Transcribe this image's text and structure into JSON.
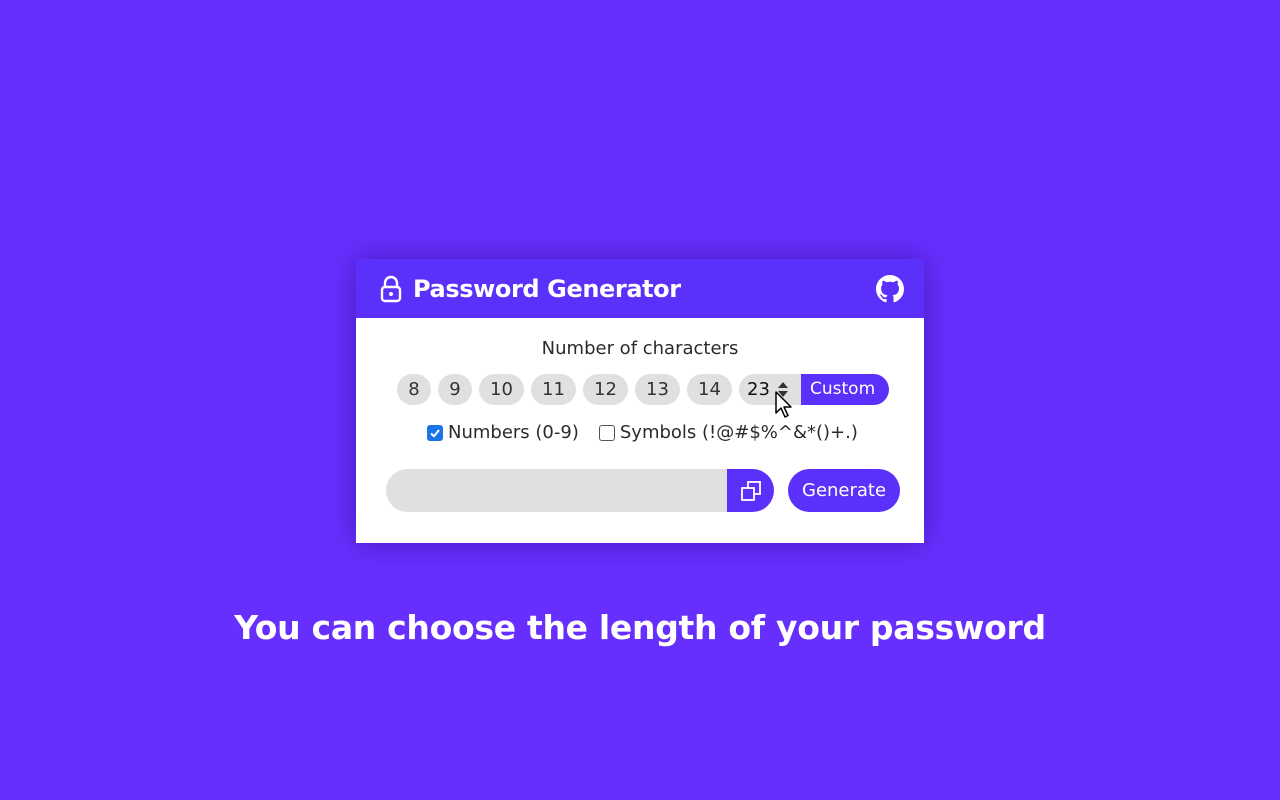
{
  "colors": {
    "background": "#672ffe",
    "accent": "#5b30fa",
    "pill": "#e0e0e0",
    "checkbox_checked": "#1a73e8"
  },
  "header": {
    "title": "Password Generator",
    "lock_icon": "lock-icon",
    "github_icon": "github-icon"
  },
  "length": {
    "label": "Number of characters",
    "options": [
      "8",
      "9",
      "10",
      "11",
      "12",
      "13",
      "14"
    ],
    "custom_value": "23",
    "custom_label": "Custom"
  },
  "options": {
    "numbers": {
      "label": "Numbers (0-9)",
      "checked": true
    },
    "symbols": {
      "label": "Symbols (!@#$%^&*()+.)",
      "checked": false
    }
  },
  "output": {
    "password": "",
    "copy_icon": "copy-icon",
    "generate_label": "Generate"
  },
  "caption": "You can choose the length of your password"
}
